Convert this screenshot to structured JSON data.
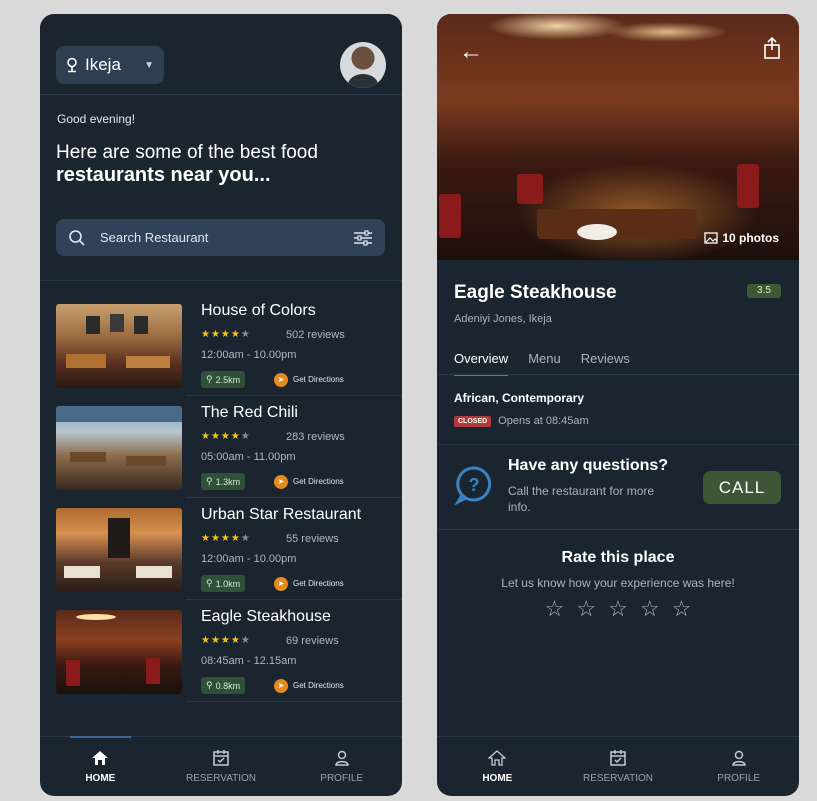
{
  "left": {
    "location": "Ikeja",
    "greeting": "Good evening!",
    "headline_line1": "Here are some of the best food",
    "headline_line2": "restaurants near you...",
    "search_placeholder": "Search Restaurant",
    "restaurants": [
      {
        "name": "House of Colors",
        "rating": 4,
        "reviews": "502 reviews",
        "hours": "12:00am - 10.00pm",
        "distance": "2.5km",
        "directions": "Get Directions"
      },
      {
        "name": "The Red Chili",
        "rating": 4,
        "reviews": "283 reviews",
        "hours": "05:00am - 11.00pm",
        "distance": "1.3km",
        "directions": "Get Directions"
      },
      {
        "name": "Urban Star Restaurant",
        "rating": 4,
        "reviews": "55 reviews",
        "hours": "12:00am - 10.00pm",
        "distance": "1.0km",
        "directions": "Get Directions"
      },
      {
        "name": "Eagle Steakhouse",
        "rating": 4,
        "reviews": "69 reviews",
        "hours": "08:45am - 12.15am",
        "distance": "0.8km",
        "directions": "Get Directions"
      }
    ],
    "nav": {
      "home": "HOME",
      "reservation": "RESERVATION",
      "profile": "PROFILE"
    }
  },
  "right": {
    "photos": "10 photos",
    "name": "Eagle Steakhouse",
    "rating": "3.5",
    "address": "Adeniyi Jones, Ikeja",
    "tabs": [
      "Overview",
      "Menu",
      "Reviews"
    ],
    "cuisine": "African, Contemporary",
    "closed_label": "CLOSED",
    "opens": "Opens at 08:45am",
    "question_title": "Have any questions?",
    "question_sub": "Call the restaurant for more info.",
    "call_label": "CALL",
    "rate_title": "Rate this place",
    "rate_sub": "Let us know how your experience was here!",
    "nav": {
      "home": "HOME",
      "reservation": "RESERVATION",
      "profile": "PROFILE"
    }
  },
  "colors": {
    "background": "#1b2530",
    "accent": "#3b82c4",
    "star": "#f5c518",
    "call": "#3e5636",
    "closed": "#b33a3a",
    "directions": "#e58a1f"
  }
}
